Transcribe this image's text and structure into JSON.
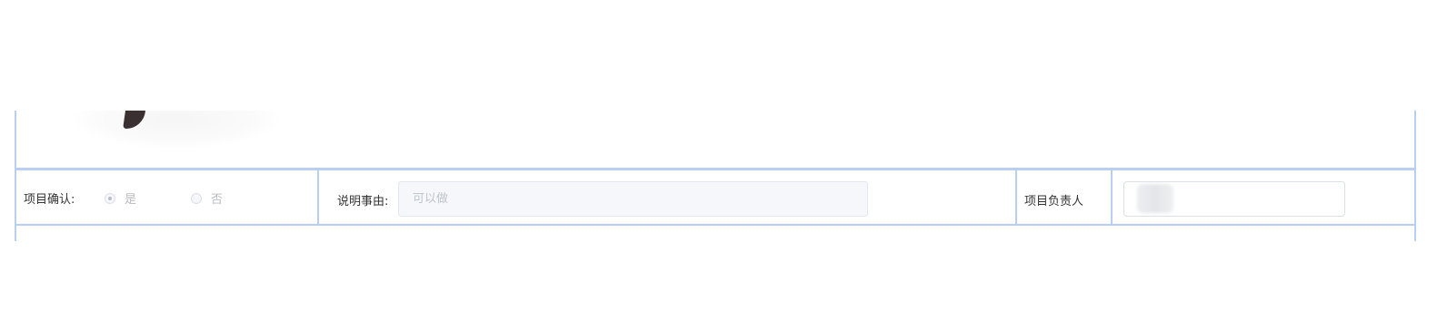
{
  "form": {
    "project_confirm": {
      "label": "项目确认:",
      "options": [
        {
          "label": "是",
          "checked": true
        },
        {
          "label": "否",
          "checked": false
        }
      ],
      "disabled": true
    },
    "explanation": {
      "label": "说明事由:",
      "placeholder": "可以做",
      "value": "",
      "disabled": true
    },
    "project_owner": {
      "label": "项目负责人",
      "value": ""
    }
  },
  "colors": {
    "border": "#b9cff0",
    "disabled_bg": "#f5f7fa",
    "disabled_text": "#c0c4cc",
    "label_text": "#333333",
    "signature_ink": "#3a2f31"
  },
  "icons": {
    "signature": "handwritten-signature-image",
    "radio_yes": "radio-checked-icon",
    "radio_no": "radio-unchecked-icon"
  }
}
